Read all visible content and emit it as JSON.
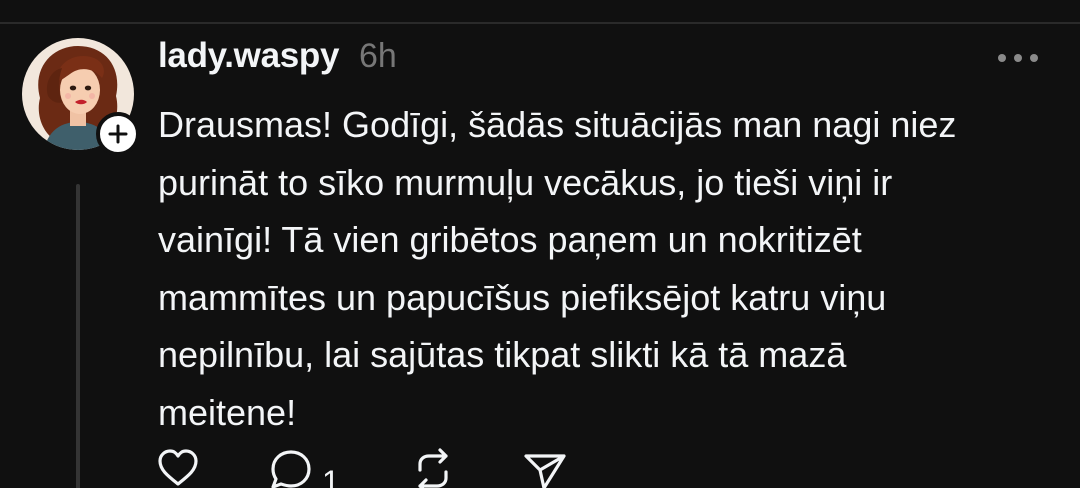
{
  "post": {
    "username": "lady.waspy",
    "time": "6h",
    "body": "Drausmas! Godīgi, šādās situācijās man nagi niez\npurināt to sīko murmuļu vecākus, jo tieši viņi ir\nvainīgi! Tā vien gribētos paņem un nokritizēt\nmammītes un papucīšus piefiksējot katru viņu\nnepilnību, lai sajūtas tikpat slikti kā tā mazā\nmeitene!"
  },
  "actions": {
    "reply_count": "1"
  },
  "icons": {
    "follow": "plus-icon",
    "more": "more-horizontal-icon",
    "like": "heart-icon",
    "reply": "comment-icon",
    "repost": "repost-icon",
    "share": "send-icon"
  },
  "colors": {
    "background": "#101010",
    "text_primary": "#f3f5f7",
    "text_secondary": "#777777",
    "divider": "#2a2a2a"
  }
}
